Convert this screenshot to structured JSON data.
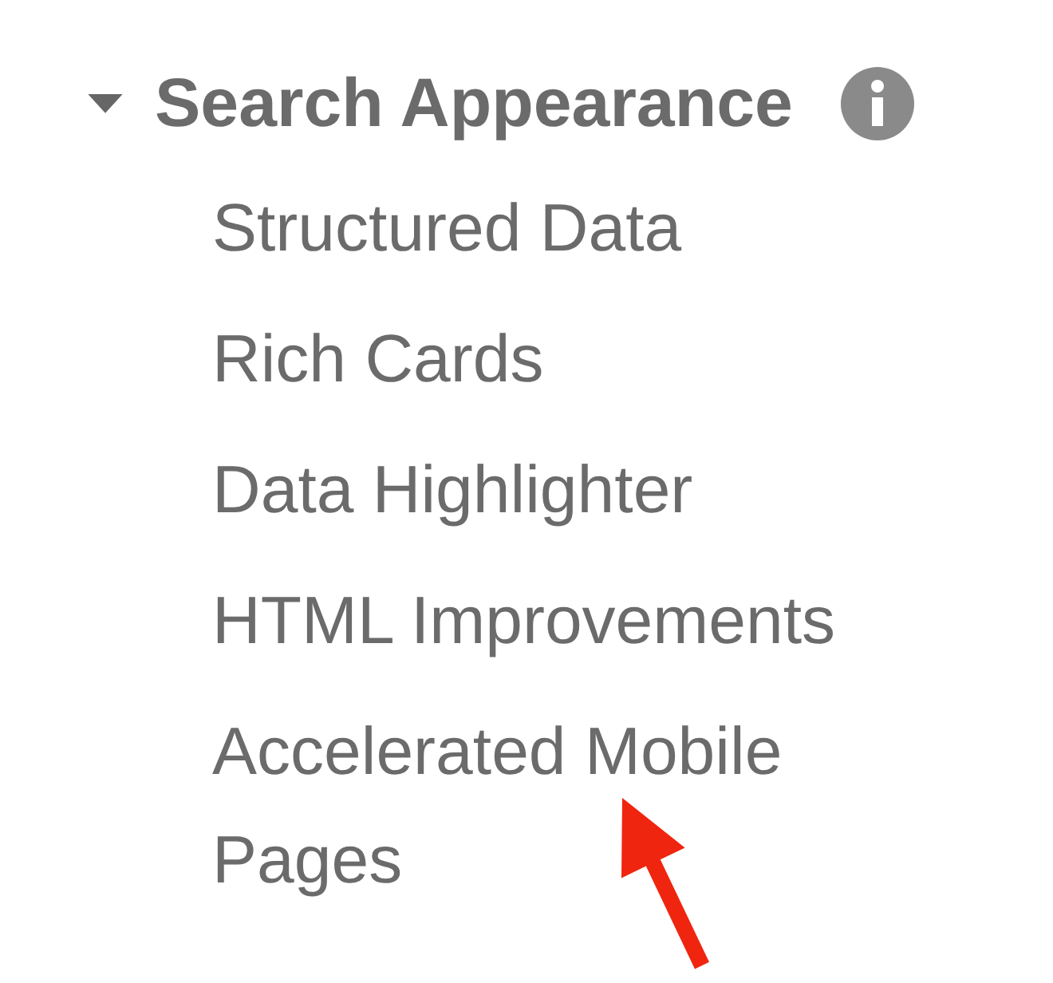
{
  "section": {
    "title": "Search Appearance",
    "expanded": true,
    "items": [
      {
        "label": "Structured Data"
      },
      {
        "label": "Rich Cards"
      },
      {
        "label": "Data Highlighter"
      },
      {
        "label": "HTML Improvements"
      },
      {
        "label": "Accelerated Mobile Pages"
      }
    ]
  }
}
